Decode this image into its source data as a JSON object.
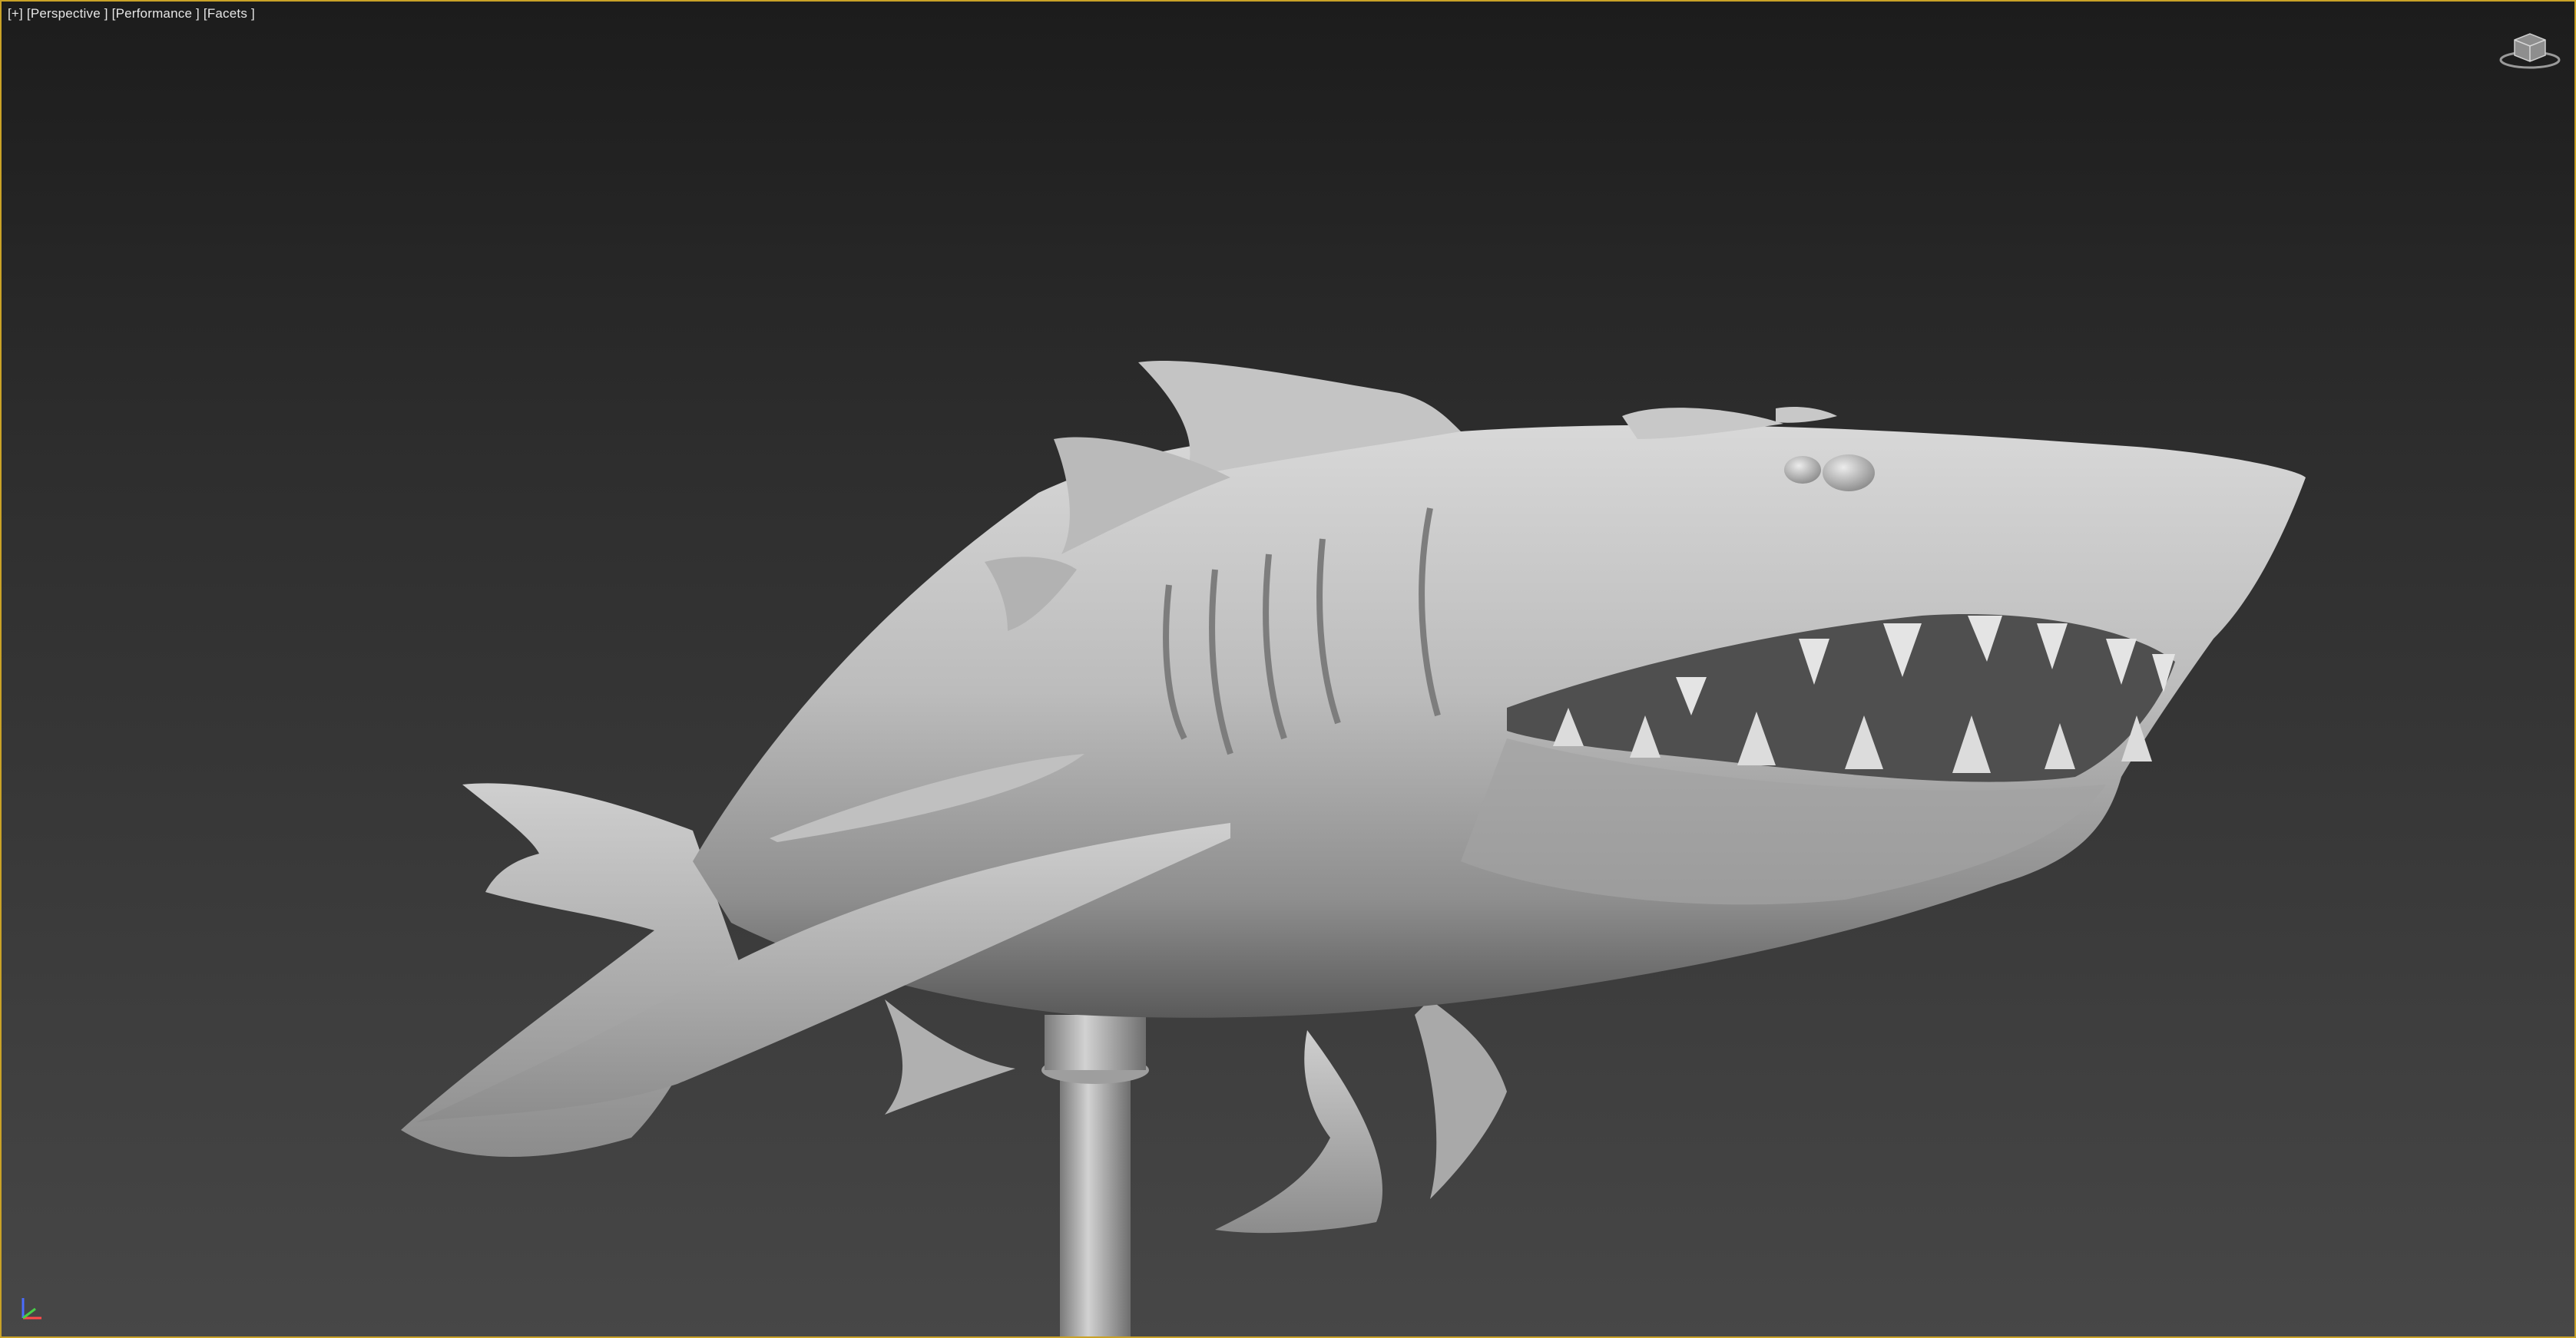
{
  "viewport": {
    "labels": {
      "menu": "[+]",
      "view": "[Perspective ]",
      "shading_mode": "[Performance ]",
      "display_mode": "[Facets ]"
    },
    "border_color": "#c9a227",
    "background_top": "#1c1c1c",
    "background_bottom": "#474747"
  },
  "icons": {
    "viewcube": "viewcube-icon",
    "axis_tripod": "axis-tripod-icon"
  },
  "scene": {
    "object": "shark sculpture on stand",
    "material_color": "#bdbdbd"
  }
}
